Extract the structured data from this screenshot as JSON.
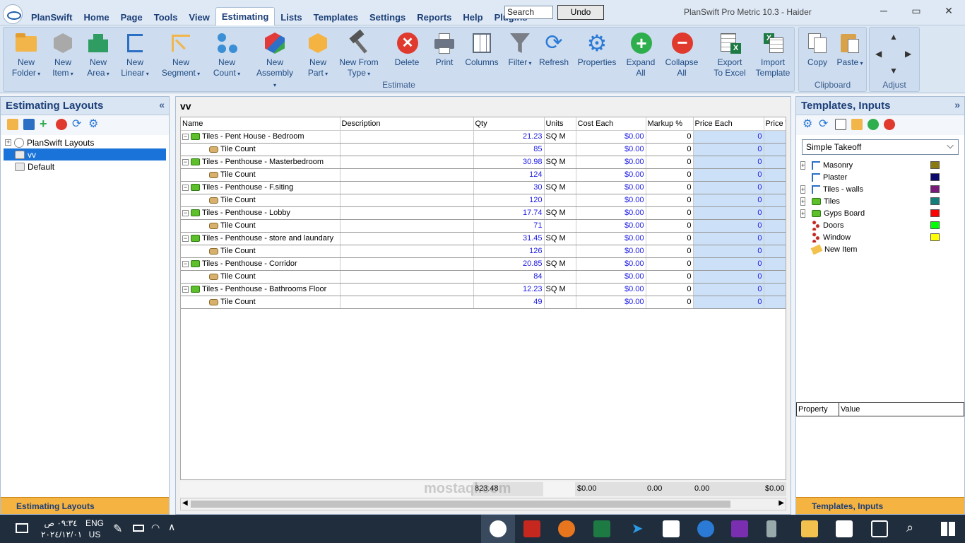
{
  "window": {
    "app_name": "PlanSwift",
    "title": "PlanSwift Pro Metric 10.3 - Haider",
    "search_placeholder": "Search",
    "undo_label": "Undo",
    "minimize": "─",
    "maximize": "▭",
    "close": "✕"
  },
  "menu": [
    "PlanSwift",
    "Home",
    "Page",
    "Tools",
    "View",
    "Estimating",
    "Lists",
    "Templates",
    "Settings",
    "Reports",
    "Help",
    "Plugins"
  ],
  "ribbon": {
    "estimate_group": "Estimate",
    "clipboard_group": "Clipboard",
    "adjust_group": "Adjust",
    "buttons": {
      "new_folder": [
        "New",
        "Folder"
      ],
      "new_item": [
        "New",
        "Item"
      ],
      "new_area": [
        "New",
        "Area"
      ],
      "new_linear": [
        "New",
        "Linear"
      ],
      "new_segment": [
        "New",
        "Segment"
      ],
      "new_count": [
        "New",
        "Count"
      ],
      "new_assembly": [
        "New",
        "Assembly"
      ],
      "new_part": [
        "New",
        "Part"
      ],
      "new_from_type": [
        "New From",
        "Type"
      ],
      "delete": "Delete",
      "print": "Print",
      "columns": "Columns",
      "filter": "Filter",
      "refresh": "Refresh",
      "properties": "Properties",
      "expand_all": [
        "Expand",
        "All"
      ],
      "collapse_all": [
        "Collapse",
        "All"
      ],
      "export_excel": [
        "Export",
        "To Excel"
      ],
      "import_template": [
        "Import",
        "Template"
      ],
      "copy": "Copy",
      "paste": "Paste"
    }
  },
  "left_panel": {
    "title": "Estimating Layouts",
    "collapse": "«",
    "tree": [
      {
        "label": "PlanSwift Layouts",
        "level": 0,
        "expander": "+"
      },
      {
        "label": "vv",
        "level": 1,
        "selected": true
      },
      {
        "label": "Default",
        "level": 1
      }
    ],
    "footer": "Estimating Layouts"
  },
  "center": {
    "layout_name": "vv",
    "columns": [
      "Name",
      "Description",
      "Qty",
      "Units",
      "Cost Each",
      "Markup %",
      "Price Each",
      "Price T"
    ],
    "rows": [
      {
        "type": "item",
        "name": "Tiles - Pent House - Bedroom",
        "qty": "21.23",
        "units": "SQ M",
        "cost": "$0.00",
        "markup": "0",
        "price": "0"
      },
      {
        "type": "count",
        "name": "Tile Count",
        "qty": "85",
        "units": "",
        "cost": "$0.00",
        "markup": "0",
        "price": "0"
      },
      {
        "type": "item",
        "name": "Tiles - Penthouse - Masterbedroom",
        "qty": "30.98",
        "units": "SQ M",
        "cost": "$0.00",
        "markup": "0",
        "price": "0"
      },
      {
        "type": "count",
        "name": "Tile Count",
        "qty": "124",
        "units": "",
        "cost": "$0.00",
        "markup": "0",
        "price": "0"
      },
      {
        "type": "item",
        "name": "Tiles - Penthouse - F.siting",
        "qty": "30",
        "units": "SQ M",
        "cost": "$0.00",
        "markup": "0",
        "price": "0"
      },
      {
        "type": "count",
        "name": "Tile Count",
        "qty": "120",
        "units": "",
        "cost": "$0.00",
        "markup": "0",
        "price": "0"
      },
      {
        "type": "item",
        "name": "Tiles - Penthouse - Lobby",
        "qty": "17.74",
        "units": "SQ M",
        "cost": "$0.00",
        "markup": "0",
        "price": "0"
      },
      {
        "type": "count",
        "name": "Tile Count",
        "qty": "71",
        "units": "",
        "cost": "$0.00",
        "markup": "0",
        "price": "0"
      },
      {
        "type": "item",
        "name": "Tiles - Penthouse - store and laundary",
        "qty": "31.45",
        "units": "SQ M",
        "cost": "$0.00",
        "markup": "0",
        "price": "0"
      },
      {
        "type": "count",
        "name": "Tile Count",
        "qty": "126",
        "units": "",
        "cost": "$0.00",
        "markup": "0",
        "price": "0"
      },
      {
        "type": "item",
        "name": "Tiles - Penthouse - Corridor",
        "qty": "20.85",
        "units": "SQ M",
        "cost": "$0.00",
        "markup": "0",
        "price": "0"
      },
      {
        "type": "count",
        "name": "Tile Count",
        "qty": "84",
        "units": "",
        "cost": "$0.00",
        "markup": "0",
        "price": "0"
      },
      {
        "type": "item",
        "name": "Tiles - Penthouse -  Bathrooms Floor",
        "qty": "12.23",
        "units": "SQ M",
        "cost": "$0.00",
        "markup": "0",
        "price": "0"
      },
      {
        "type": "count",
        "name": "Tile Count",
        "qty": "49",
        "units": "",
        "cost": "$0.00",
        "markup": "0",
        "price": "0"
      }
    ],
    "totals": {
      "qty": "823.48",
      "cost": "$0.00",
      "markup": "0.00",
      "price": "0.00",
      "price_total": "$0.00"
    }
  },
  "right_panel": {
    "title": "Templates, Inputs",
    "expand": "»",
    "template_select": "Simple Takeoff",
    "templates": [
      {
        "label": "Masonry",
        "color": "#8b7a10",
        "expander": "+",
        "icon": "linear"
      },
      {
        "label": "Plaster",
        "color": "#0a0a6e",
        "expander": "",
        "icon": "linear"
      },
      {
        "label": "Tiles - walls",
        "color": "#7a1a7a",
        "expander": "+",
        "icon": "linear"
      },
      {
        "label": "Tiles",
        "color": "#12807a",
        "expander": "+",
        "icon": "area"
      },
      {
        "label": "Gyps Board",
        "color": "#ff0000",
        "expander": "+",
        "icon": "area"
      },
      {
        "label": "Doors",
        "color": "#00ff00",
        "expander": "",
        "icon": "count"
      },
      {
        "label": "Window",
        "color": "#ffff00",
        "expander": "",
        "icon": "count"
      },
      {
        "label": "New Item",
        "color": "",
        "expander": "",
        "icon": "new"
      }
    ],
    "property_header": "Property",
    "value_header": "Value",
    "footer": "Templates, Inputs"
  },
  "taskbar": {
    "time": "٠٩:٣٤ ص",
    "date": "٢٠٢٤/١٢/٠١",
    "lang": "ENG",
    "region": "US"
  },
  "watermark": "mostaql.com"
}
